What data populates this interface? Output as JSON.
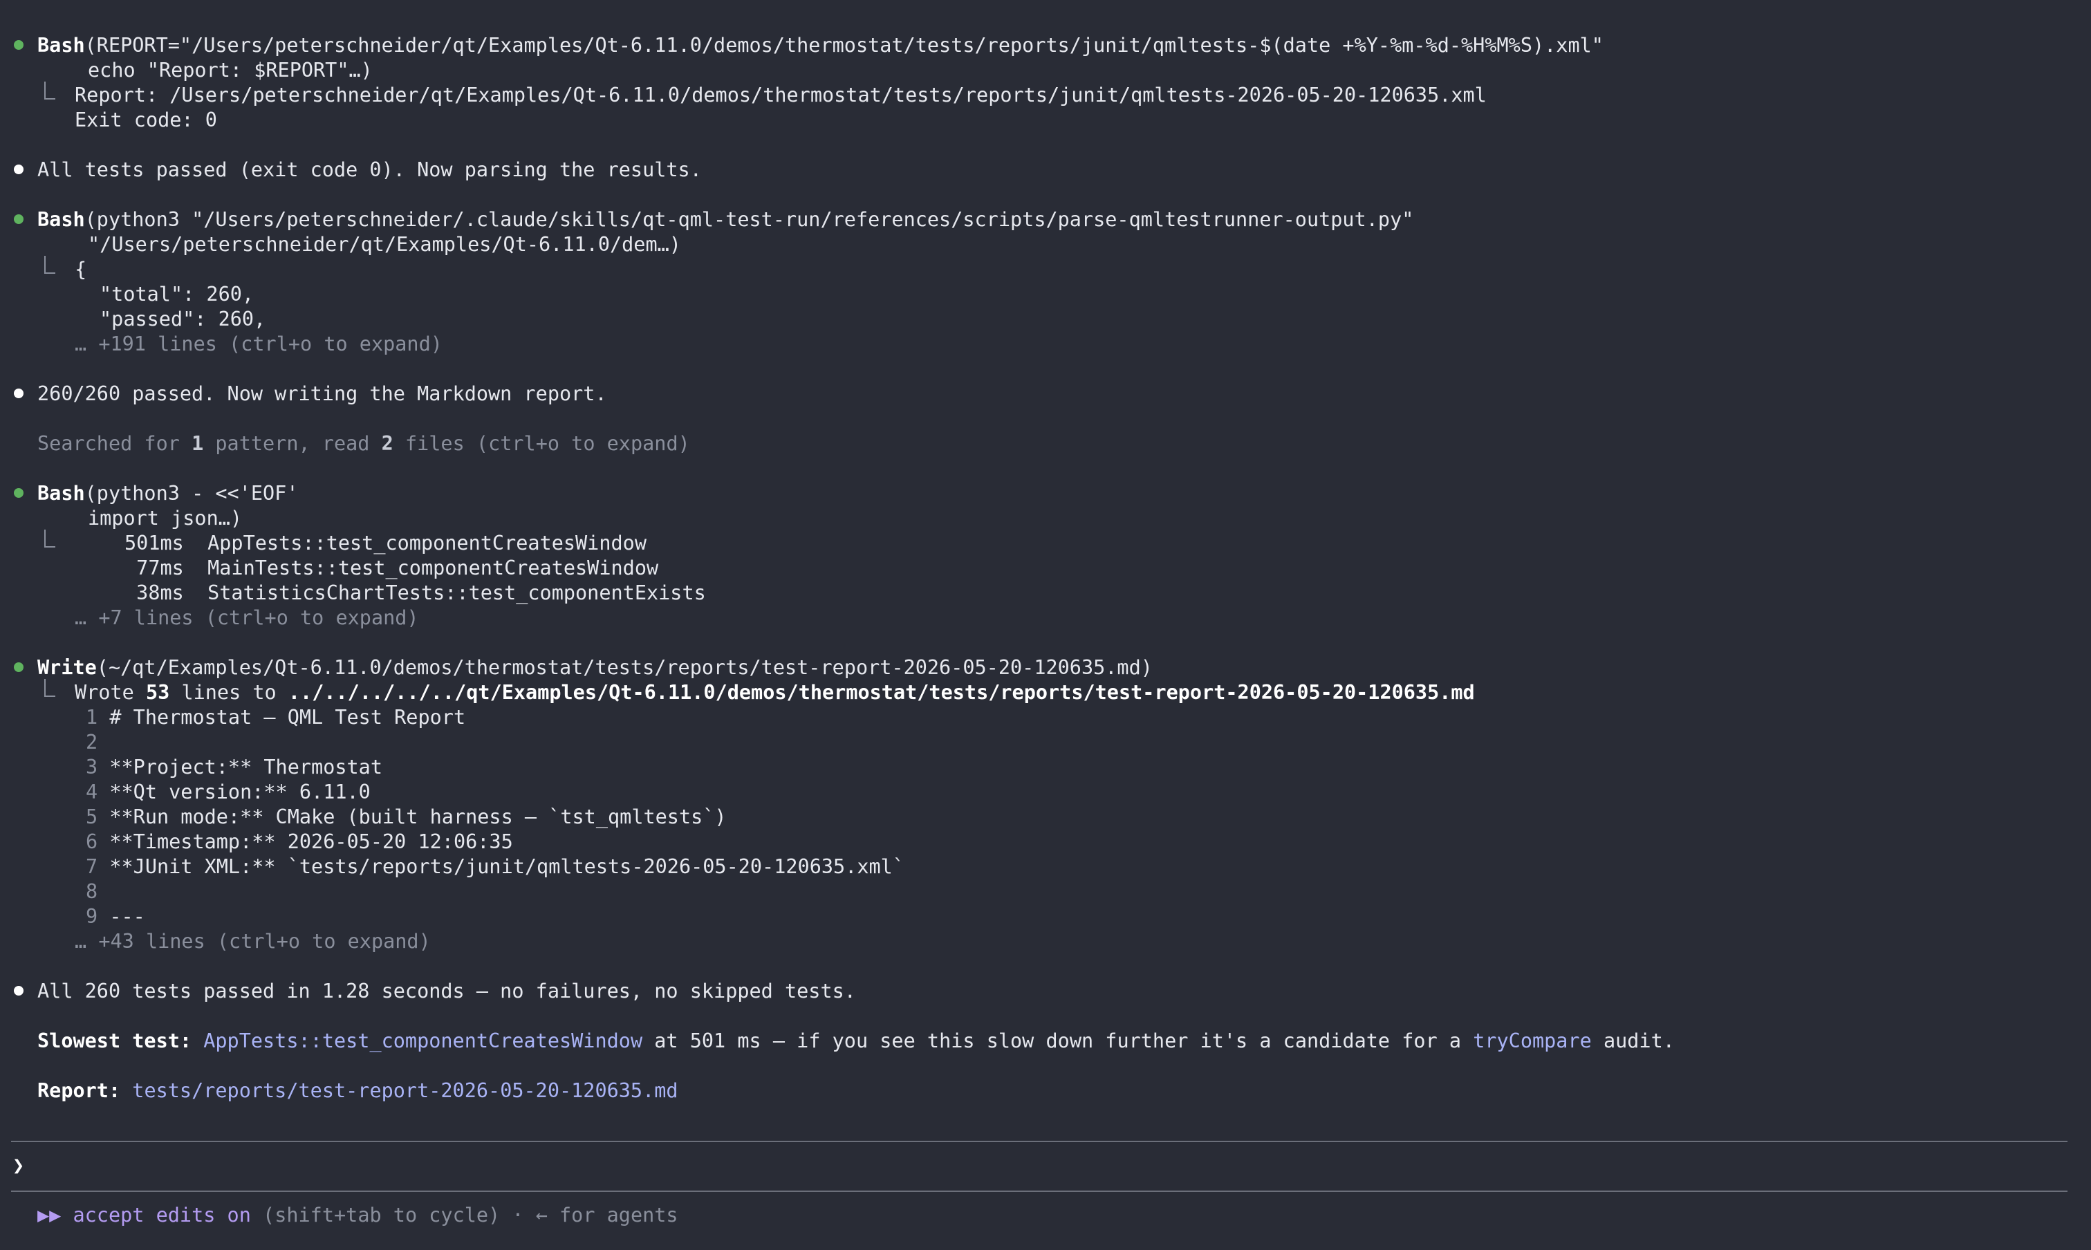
{
  "blocks": {
    "b1": {
      "tool": "Bash",
      "cmd1": "(REPORT=\"/Users/peterschneider/qt/Examples/Qt-6.11.0/demos/thermostat/tests/reports/junit/qmltests-$(date +%Y-%m-%d-%H%M%S).xml\"",
      "cmd2": "echo \"Report: $REPORT\"…)",
      "out1": "Report: /Users/peterschneider/qt/Examples/Qt-6.11.0/demos/thermostat/tests/reports/junit/qmltests-2026-05-20-120635.xml",
      "out2": "Exit code: 0"
    },
    "m1": "All tests passed (exit code 0). Now parsing the results.",
    "b2": {
      "tool": "Bash",
      "cmd1": "(python3 \"/Users/peterschneider/.claude/skills/qt-qml-test-run/references/scripts/parse-qmltestrunner-output.py\"",
      "cmd2": "\"/Users/peterschneider/qt/Examples/Qt-6.11.0/dem…)",
      "out1": "{",
      "out2": "\"total\": 260,",
      "out3": "\"passed\": 260,",
      "more": "… +191 lines (ctrl+o to expand)"
    },
    "m2": "260/260 passed. Now writing the Markdown report.",
    "search": {
      "pre": "Searched for ",
      "n1": "1",
      "mid": " pattern, read ",
      "n2": "2",
      "post": " files (ctrl+o to expand)"
    },
    "b3": {
      "tool": "Bash",
      "cmd1": "(python3 - <<'EOF'",
      "cmd2": "import json…)",
      "out1": "501ms  AppTests::test_componentCreatesWindow",
      "out2": " 77ms  MainTests::test_componentCreatesWindow",
      "out3": " 38ms  StatisticsChartTests::test_componentExists",
      "more": "… +7 lines (ctrl+o to expand)"
    },
    "w": {
      "tool": "Write",
      "cmd1": "(~/qt/Examples/Qt-6.11.0/demos/thermostat/tests/reports/test-report-2026-05-20-120635.md)",
      "wrote_pre": "Wrote ",
      "wrote_n": "53",
      "wrote_mid": " lines to ",
      "wrote_path": "../../../../../qt/Examples/Qt-6.11.0/demos/thermostat/tests/reports/test-report-2026-05-20-120635.md",
      "lines": [
        {
          "n": "1",
          "t": "# Thermostat — QML Test Report"
        },
        {
          "n": "2",
          "t": ""
        },
        {
          "n": "3",
          "t": "**Project:** Thermostat"
        },
        {
          "n": "4",
          "t": "**Qt version:** 6.11.0"
        },
        {
          "n": "5",
          "t": "**Run mode:** CMake (built harness — `tst_qmltests`)"
        },
        {
          "n": "6",
          "t": "**Timestamp:** 2026-05-20 12:06:35"
        },
        {
          "n": "7",
          "t": "**JUnit XML:** `tests/reports/junit/qmltests-2026-05-20-120635.xml`"
        },
        {
          "n": "8",
          "t": ""
        },
        {
          "n": "9",
          "t": "---"
        }
      ],
      "more": "… +43 lines (ctrl+o to expand)"
    },
    "m3": "All 260 tests passed in 1.28 seconds — no failures, no skipped tests.",
    "slowest": {
      "label": "Slowest test:",
      "link": "AppTests::test_componentCreatesWindow",
      "mid": " at 501 ms — if you see this slow down further it's a candidate for a ",
      "link2": "tryCompare",
      "post": " audit."
    },
    "report": {
      "label": "Report:",
      "link": "tests/reports/test-report-2026-05-20-120635.md"
    }
  },
  "prompt": {
    "caret": "❯",
    "value": ""
  },
  "footer": {
    "mode_icon": "▶▶",
    "mode_label": "accept edits on",
    "hint": " (shift+tab to cycle) · ← for agents"
  },
  "colors": {
    "background": "#292c36",
    "success_bullet": "#5fb35f",
    "link": "#a9b3f5",
    "mode": "#b49cf2"
  }
}
